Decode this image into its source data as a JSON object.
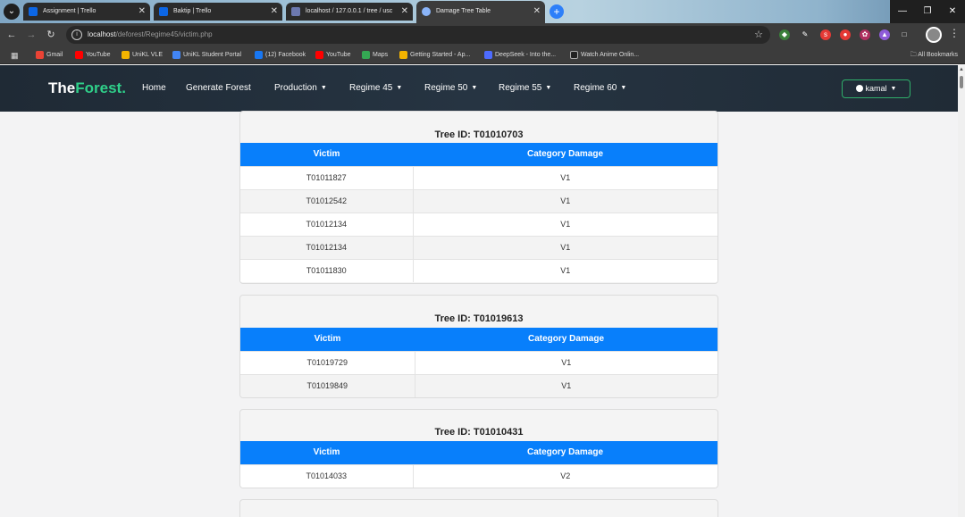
{
  "browser": {
    "tabs": [
      {
        "title": "Assignment | Trello",
        "color": "#0c66e4"
      },
      {
        "title": "Baktip | Trello",
        "color": "#0c66e4"
      },
      {
        "title": "localhost / 127.0.0.1 / tree / usc",
        "color": "#6c78af"
      },
      {
        "title": "Damage Tree Table",
        "color": "#8ab4f8"
      }
    ],
    "url_host": "localhost",
    "url_path": "/deforest/Regime45/victim.php",
    "bookmarks": [
      {
        "label": "Gmail",
        "color": "#ea4335"
      },
      {
        "label": "YouTube",
        "color": "#ff0000"
      },
      {
        "label": "UniKL VLE",
        "color": "#f4b400"
      },
      {
        "label": "UniKL Student Portal",
        "color": "#4285f4"
      },
      {
        "label": "(12) Facebook",
        "color": "#1877f2"
      },
      {
        "label": "YouTube",
        "color": "#ff0000"
      },
      {
        "label": "Maps",
        "color": "#34a853"
      },
      {
        "label": "Getting Started - Ap...",
        "color": "#f4b400"
      },
      {
        "label": "DeepSeek - Into the...",
        "color": "#4d6bfe"
      },
      {
        "label": "Watch Anime Onlin...",
        "color": "#222222"
      }
    ],
    "all_bookmarks": "All Bookmarks"
  },
  "navbar": {
    "brand_a": "The",
    "brand_b": "Forest.",
    "links": [
      "Home",
      "Generate Forest",
      "Production",
      "Regime 45",
      "Regime 50",
      "Regime 55",
      "Regime 60"
    ],
    "user": "kamal"
  },
  "columns": {
    "victim": "Victim",
    "damage": "Category Damage"
  },
  "tables": [
    {
      "title": "Tree ID: T01010703",
      "rows": [
        {
          "victim": "T01011827",
          "damage": "V1"
        },
        {
          "victim": "T01012542",
          "damage": "V1"
        },
        {
          "victim": "T01012134",
          "damage": "V1"
        },
        {
          "victim": "T01012134",
          "damage": "V1"
        },
        {
          "victim": "T01011830",
          "damage": "V1"
        }
      ]
    },
    {
      "title": "Tree ID: T01019613",
      "rows": [
        {
          "victim": "T01019729",
          "damage": "V1"
        },
        {
          "victim": "T01019849",
          "damage": "V1"
        }
      ]
    },
    {
      "title": "Tree ID: T01010431",
      "rows": [
        {
          "victim": "T01014033",
          "damage": "V2"
        }
      ]
    }
  ]
}
